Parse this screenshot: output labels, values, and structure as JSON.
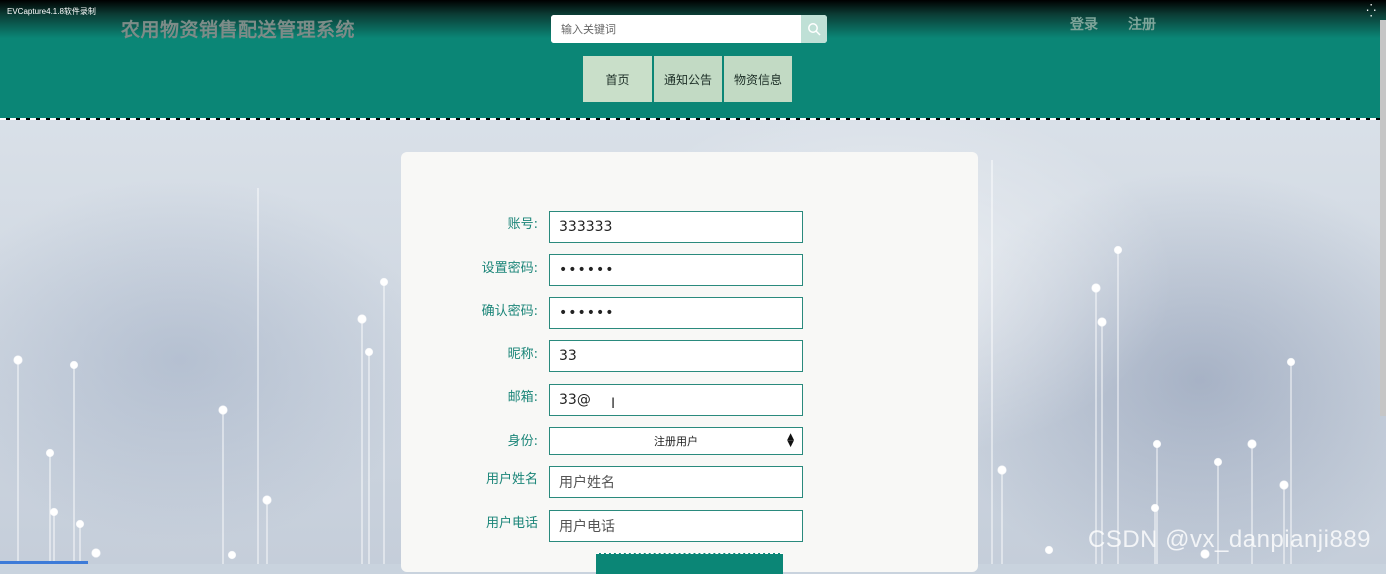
{
  "capture_label": "EVCapture4.1.8软件录制",
  "header": {
    "site_title": "农用物资销售配送管理系统",
    "search_placeholder": "输入关键词",
    "login_label": "登录",
    "register_label": "注册"
  },
  "nav": [
    {
      "label": "首页"
    },
    {
      "label": "通知公告"
    },
    {
      "label": "物资信息"
    }
  ],
  "form": {
    "fields": [
      {
        "label": "账号:",
        "value": "333333",
        "type": "text"
      },
      {
        "label": "设置密码:",
        "value": "••••••",
        "type": "password"
      },
      {
        "label": "确认密码:",
        "value": "••••••",
        "type": "password"
      },
      {
        "label": "昵称:",
        "value": "33",
        "type": "text"
      },
      {
        "label": "邮箱:",
        "value": "33@",
        "type": "text"
      },
      {
        "label": "身份:",
        "value": "注册用户",
        "type": "select"
      },
      {
        "label": "用户姓名",
        "placeholder": "用户姓名",
        "type": "text"
      },
      {
        "label": "用户电话",
        "placeholder": "用户电话",
        "type": "text"
      }
    ]
  },
  "watermark": "CSDN @vx_danpianji889",
  "colors": {
    "header_bg": "#0b8676",
    "nav_bg": "#c2dac4",
    "label_color": "#1a8578",
    "input_border": "#2a8a7d"
  }
}
